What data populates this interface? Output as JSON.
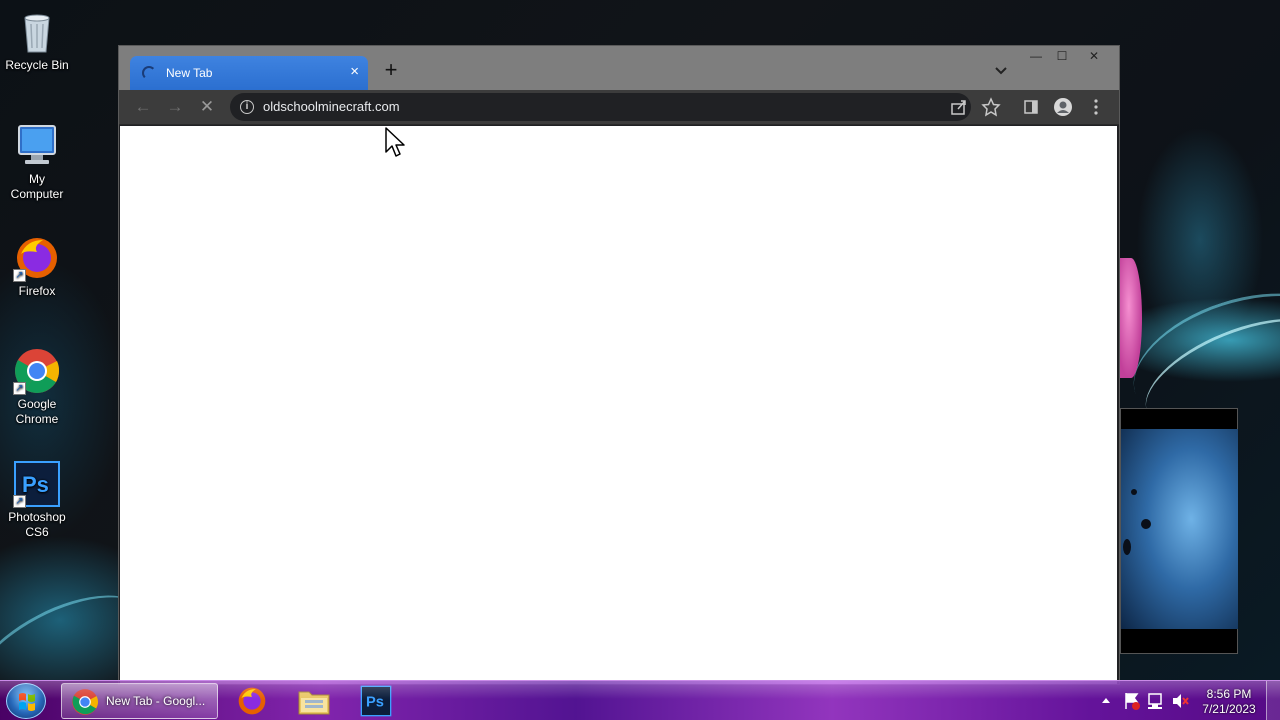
{
  "desktop": {
    "icons": [
      {
        "label": "Recycle Bin",
        "icon": "recycle-bin-icon"
      },
      {
        "label": "My Computer",
        "icon": "computer-icon"
      },
      {
        "label": "Firefox",
        "icon": "firefox-icon"
      },
      {
        "label": "Google Chrome",
        "icon": "chrome-icon"
      },
      {
        "label": "Photoshop CS6",
        "icon": "photoshop-icon"
      }
    ]
  },
  "browser": {
    "tab": {
      "title": "New Tab",
      "close": "×",
      "loading": true
    },
    "new_tab": "+",
    "window_controls": {
      "minimize": "—",
      "maximize": "☐",
      "close": "✕"
    },
    "nav": {
      "back": "←",
      "forward": "→",
      "stop": "✕"
    },
    "omnibox": {
      "url": "oldschoolminecraft.com",
      "info": "i"
    },
    "accent": "#2b6fd0"
  },
  "taskbar": {
    "start": "start-orb-icon",
    "items": [
      {
        "label": "New Tab - Googl...",
        "icon": "chrome-icon",
        "active": true
      },
      {
        "label": "",
        "icon": "firefox-icon"
      },
      {
        "label": "",
        "icon": "file-explorer-icon"
      },
      {
        "label": "",
        "icon": "photoshop-icon"
      }
    ],
    "clock": {
      "time": "8:56 PM",
      "date": "7/21/2023"
    }
  }
}
